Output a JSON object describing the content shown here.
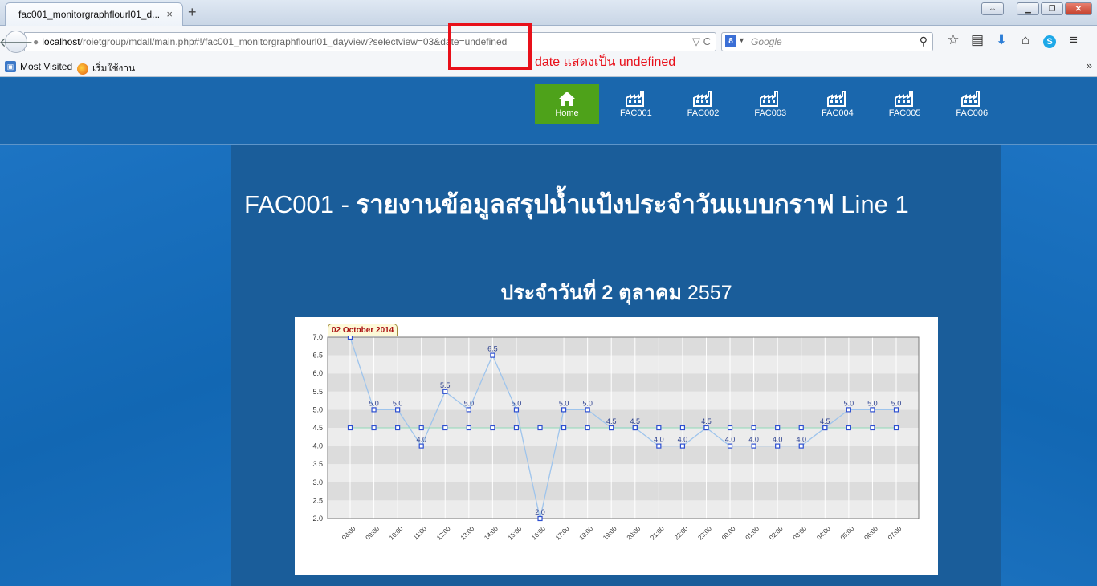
{
  "browser": {
    "tab_title": "fac001_monitorgraphflourl01_d...",
    "tab_close": "×",
    "new_tab": "+",
    "url_host": "localhost",
    "url_path": "/roietgroup/mdall/main.php#!/fac001_monitorgraphflourl01_dayview?selectview=03&date=undefined",
    "url_controls": "▽ C",
    "search_engine": "8",
    "search_placeholder": "Google",
    "bookmarks": [
      {
        "label": "Most Visited"
      },
      {
        "label": "เริ่มใช้งาน"
      }
    ],
    "bookmarks_more": "»"
  },
  "annotation": {
    "text": "date แสดงเป็น undefined",
    "color": "#e8101a"
  },
  "site_nav": {
    "items": [
      {
        "label": "Home",
        "icon": "home-icon",
        "active": true
      },
      {
        "label": "FAC001",
        "icon": "factory-icon"
      },
      {
        "label": "FAC002",
        "icon": "factory-icon"
      },
      {
        "label": "FAC003",
        "icon": "factory-icon"
      },
      {
        "label": "FAC004",
        "icon": "factory-icon"
      },
      {
        "label": "FAC005",
        "icon": "factory-icon"
      },
      {
        "label": "FAC006",
        "icon": "factory-icon"
      }
    ],
    "active_color": "#4ea21a"
  },
  "page": {
    "title_prefix": "FAC001 - ",
    "title_bold": "รายงานข้อมูลสรุปน้ำแป้งประจำวันแบบกราฟ",
    "title_suffix": " Line 1",
    "date_bold": "ประจำวันที่ 2 ตุลาคม",
    "date_year": " 2557"
  },
  "chart_data": {
    "type": "line",
    "title": "02 October 2014",
    "categories": [
      "08:00",
      "09:00",
      "10:00",
      "11:00",
      "12:00",
      "13:00",
      "14:00",
      "15:00",
      "16:00",
      "17:00",
      "18:00",
      "19:00",
      "20:00",
      "21:00",
      "22:00",
      "23:00",
      "00:00",
      "01:00",
      "02:00",
      "03:00",
      "04:00",
      "05:00",
      "06:00",
      "07:00"
    ],
    "series": [
      {
        "values": [
          7.0,
          5.0,
          5.0,
          4.0,
          5.5,
          5.0,
          6.5,
          5.0,
          2.0,
          5.0,
          5.0,
          4.5,
          4.5,
          4.0,
          4.0,
          4.5,
          4.0,
          4.0,
          4.0,
          4.0,
          4.5,
          5.0,
          5.0,
          5.0
        ],
        "color": "#9ec4ec"
      },
      {
        "values": [
          4.5,
          4.5,
          4.5,
          4.5,
          4.5,
          4.5,
          4.5,
          4.5,
          4.5,
          4.5,
          4.5,
          4.5,
          4.5,
          4.5,
          4.5,
          4.5,
          4.5,
          4.5,
          4.5,
          4.5,
          4.5,
          4.5,
          4.5,
          4.5
        ],
        "color": "#8fd9b8"
      }
    ],
    "data_labels": [
      "",
      "5.0",
      "5.0",
      "4.0",
      "5.5",
      "5.0",
      "6.5",
      "5.0",
      "2.0",
      "5.0",
      "5.0",
      "4.5",
      "4.5",
      "4.0",
      "4.0",
      "4.5",
      "4.0",
      "4.0",
      "4.0",
      "4.0",
      "4.5",
      "5.0",
      "5.0",
      "5.0"
    ],
    "ylim": [
      2.0,
      7.0
    ],
    "yticks": [
      "2.0",
      "2.5",
      "3.0",
      "3.5",
      "4.0",
      "4.5",
      "5.0",
      "5.5",
      "6.0",
      "6.5",
      "7.0"
    ],
    "grid": true
  }
}
